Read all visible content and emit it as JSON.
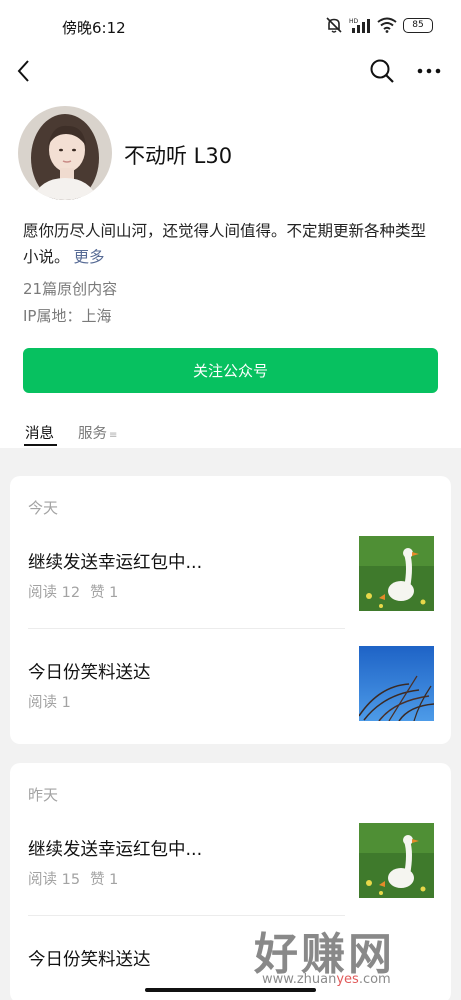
{
  "status_bar": {
    "time": "傍晚6:12",
    "battery": "85"
  },
  "profile": {
    "name": "不动听 L30",
    "description": "愿你历尽人间山河，还觉得人间值得。不定期更新各种类型小说。",
    "more_label": "更多",
    "original_count": "21篇原创内容",
    "ip_location": "IP属地：上海",
    "follow_button": "关注公众号"
  },
  "tabs": {
    "messages": "消息",
    "services": "服务",
    "services_glyph": "≡"
  },
  "feed": [
    {
      "date": "今天",
      "articles": [
        {
          "title": "继续发送幸运红包中...",
          "reads": "阅读 12",
          "likes": "赞 1",
          "thumbnail": "goose-on-grass"
        },
        {
          "title": "今日份笑料送达",
          "reads": "阅读 1",
          "likes": "",
          "thumbnail": "grass-against-blue-sky"
        }
      ]
    },
    {
      "date": "昨天",
      "articles": [
        {
          "title": "继续发送幸运红包中...",
          "reads": "阅读 15",
          "likes": "赞 1",
          "thumbnail": "goose-on-grass"
        },
        {
          "title": "今日份笑料送达",
          "reads": "",
          "likes": "",
          "thumbnail": ""
        }
      ]
    }
  ],
  "watermark": {
    "text": "好赚网",
    "url_prefix": "www.zhuan",
    "url_accent": "yes",
    "url_suffix": ".com"
  },
  "colors": {
    "accent_green": "#07c160",
    "link_blue": "#576b95",
    "background": "#f2f2f2"
  }
}
